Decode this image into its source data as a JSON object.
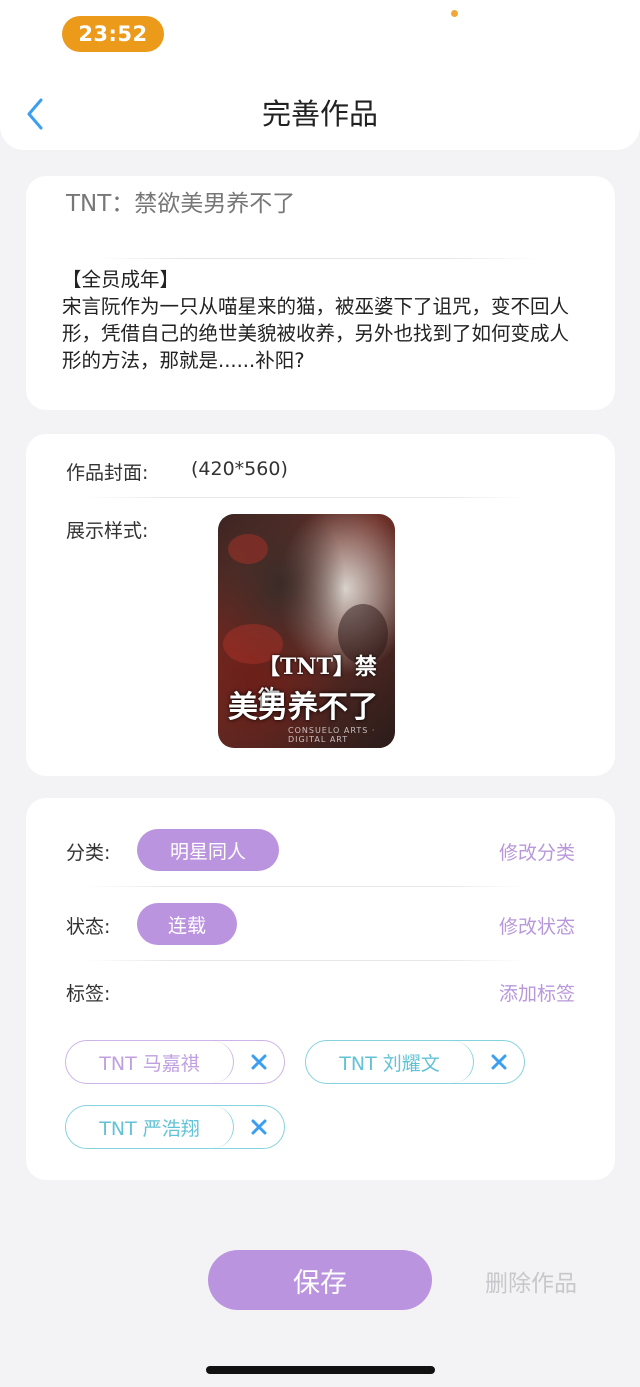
{
  "status_bar": {
    "time": "23:52"
  },
  "header": {
    "title": "完善作品"
  },
  "work": {
    "title": "TNT：禁欲美男养不了",
    "description": "【全员成年】\n宋言阮作为一只从喵星来的猫，被巫婆下了诅咒，变不回人形，凭借自己的绝世美貌被收养，另外也找到了如何变成人形的方法，那就是......补阳?"
  },
  "cover": {
    "label": "作品封面:",
    "size": "(420*560)",
    "display_label": "展示样式:",
    "image_text_line1": "【TNT】禁欲",
    "image_text_line2": "美男养不了",
    "image_subtext": "CONSUELO ARTS · DIGITAL ART"
  },
  "category": {
    "label": "分类:",
    "value": "明星同人",
    "action": "修改分类"
  },
  "status": {
    "label": "状态:",
    "value": "连载",
    "action": "修改状态"
  },
  "tags": {
    "label": "标签:",
    "action": "添加标签",
    "items": [
      {
        "text": "TNT 马嘉祺",
        "color": "#c0a0e0"
      },
      {
        "text": "TNT 刘耀文",
        "color": "#62c3d6"
      },
      {
        "text": "TNT 严浩翔",
        "color": "#62c3d6"
      }
    ]
  },
  "footer": {
    "save": "保存",
    "delete": "删除作品"
  },
  "colors": {
    "accent": "#bb94e0",
    "status_time": "#eb9a1a",
    "back": "#3a9ff0"
  }
}
